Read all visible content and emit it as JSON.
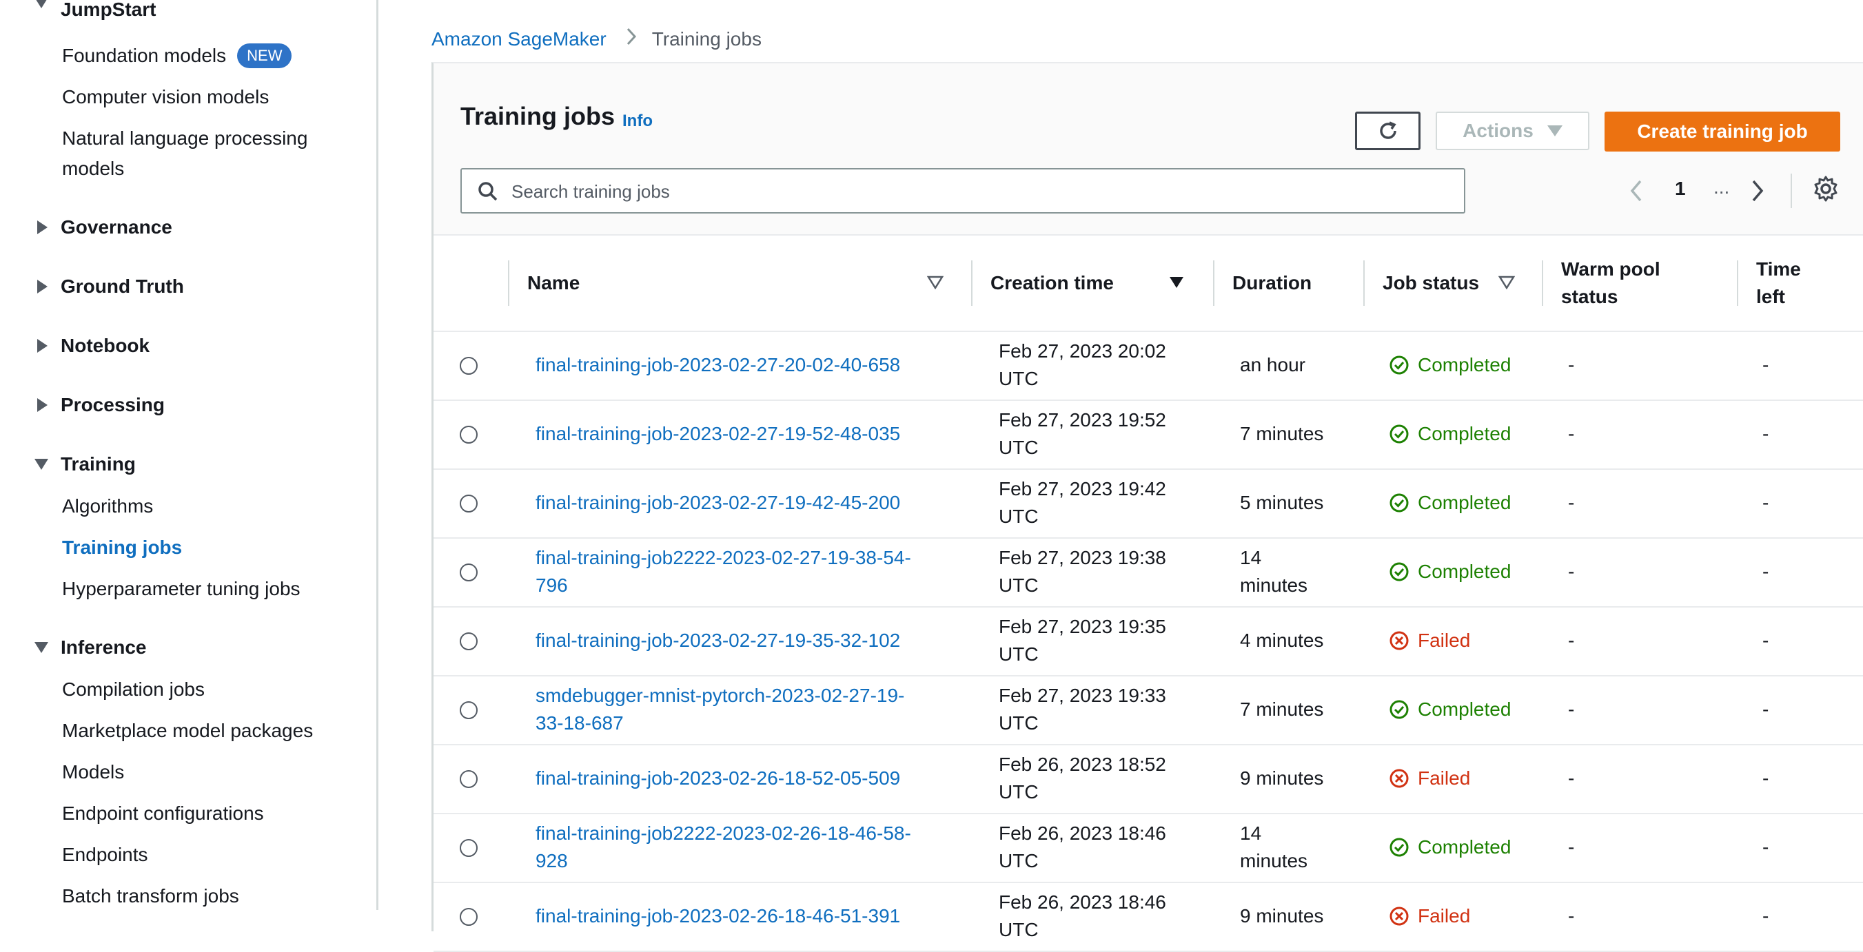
{
  "sidebar": {
    "sections": [
      {
        "label": "JumpStart",
        "expanded": true
      },
      {
        "label": "Governance",
        "expanded": false
      },
      {
        "label": "Ground Truth",
        "expanded": false
      },
      {
        "label": "Notebook",
        "expanded": false
      },
      {
        "label": "Processing",
        "expanded": false
      },
      {
        "label": "Training",
        "expanded": true
      },
      {
        "label": "Inference",
        "expanded": true
      }
    ],
    "jumpstart_items": [
      {
        "label": "Foundation models",
        "badge": "NEW"
      },
      {
        "label": "Computer vision models"
      },
      {
        "label": "Natural language processing"
      },
      {
        "label": "models"
      }
    ],
    "training_items": [
      {
        "label": "Algorithms"
      },
      {
        "label": "Training jobs",
        "active": true
      },
      {
        "label": "Hyperparameter tuning jobs"
      }
    ],
    "inference_items": [
      {
        "label": "Compilation jobs"
      },
      {
        "label": "Marketplace model packages"
      },
      {
        "label": "Models"
      },
      {
        "label": "Endpoint configurations"
      },
      {
        "label": "Endpoints"
      },
      {
        "label": "Batch transform jobs"
      }
    ]
  },
  "breadcrumb": {
    "root": "Amazon SageMaker",
    "current": "Training jobs"
  },
  "header": {
    "title": "Training jobs",
    "info": "Info",
    "actions_label": "Actions",
    "create_label": "Create training job",
    "search_placeholder": "Search training jobs",
    "page_number": "1",
    "page_ellipsis": "..."
  },
  "table": {
    "columns": {
      "name": "Name",
      "creation_time": "Creation time",
      "duration": "Duration",
      "job_status": "Job status",
      "warm_pool_1": "Warm pool",
      "warm_pool_2": "status",
      "time_left_1": "Time",
      "time_left_2": "left"
    },
    "rows": [
      {
        "name1": "final-training-job-2023-02-27-20-02-40-658",
        "name2": "",
        "time1": "Feb 27, 2023 20:02",
        "time2": "UTC",
        "dur1": "an hour",
        "dur2": "",
        "status": "Completed",
        "ok": true,
        "warm": "-",
        "left": "-"
      },
      {
        "name1": "final-training-job-2023-02-27-19-52-48-035",
        "name2": "",
        "time1": "Feb 27, 2023 19:52",
        "time2": "UTC",
        "dur1": "7 minutes",
        "dur2": "",
        "status": "Completed",
        "ok": true,
        "warm": "-",
        "left": "-"
      },
      {
        "name1": "final-training-job-2023-02-27-19-42-45-200",
        "name2": "",
        "time1": "Feb 27, 2023 19:42",
        "time2": "UTC",
        "dur1": "5 minutes",
        "dur2": "",
        "status": "Completed",
        "ok": true,
        "warm": "-",
        "left": "-"
      },
      {
        "name1": "final-training-job2222-2023-02-27-19-38-54-",
        "name2": "796",
        "time1": "Feb 27, 2023 19:38",
        "time2": "UTC",
        "dur1": "14",
        "dur2": "minutes",
        "status": "Completed",
        "ok": true,
        "warm": "-",
        "left": "-"
      },
      {
        "name1": "final-training-job-2023-02-27-19-35-32-102",
        "name2": "",
        "time1": "Feb 27, 2023 19:35",
        "time2": "UTC",
        "dur1": "4 minutes",
        "dur2": "",
        "status": "Failed",
        "ok": false,
        "warm": "-",
        "left": "-"
      },
      {
        "name1": "smdebugger-mnist-pytorch-2023-02-27-19-",
        "name2": "33-18-687",
        "time1": "Feb 27, 2023 19:33",
        "time2": "UTC",
        "dur1": "7 minutes",
        "dur2": "",
        "status": "Completed",
        "ok": true,
        "warm": "-",
        "left": "-"
      },
      {
        "name1": "final-training-job-2023-02-26-18-52-05-509",
        "name2": "",
        "time1": "Feb 26, 2023 18:52",
        "time2": "UTC",
        "dur1": "9 minutes",
        "dur2": "",
        "status": "Failed",
        "ok": false,
        "warm": "-",
        "left": "-"
      },
      {
        "name1": "final-training-job2222-2023-02-26-18-46-58-",
        "name2": "928",
        "time1": "Feb 26, 2023 18:46",
        "time2": "UTC",
        "dur1": "14",
        "dur2": "minutes",
        "status": "Completed",
        "ok": true,
        "warm": "-",
        "left": "-"
      },
      {
        "name1": "final-training-job-2023-02-26-18-46-51-391",
        "name2": "",
        "time1": "Feb 26, 2023 18:46",
        "time2": "UTC",
        "dur1": "9 minutes",
        "dur2": "",
        "status": "Failed",
        "ok": false,
        "warm": "-",
        "left": "-"
      }
    ]
  },
  "colors": {
    "link": "#0f6ebf",
    "primary": "#ec7211",
    "success": "#1d8102",
    "error": "#d13212"
  }
}
